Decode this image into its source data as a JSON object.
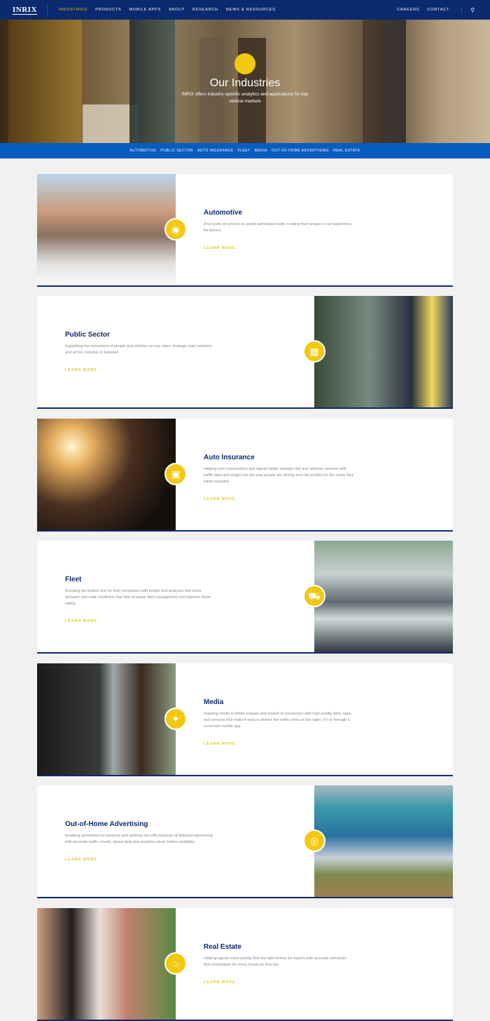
{
  "nav": {
    "logo": "INRIX",
    "items": [
      "INDUSTRIES",
      "PRODUCTS",
      "MOBILE APPS",
      "ABOUT",
      "RESEARCH",
      "NEWS & RESOURCES"
    ],
    "right": [
      "CAREERS",
      "CONTACT"
    ],
    "search_icon": "search-icon"
  },
  "hero": {
    "title": "Our Industries",
    "subtitle": "INRIX offers industry-specific analytics and applications for key vertical markets"
  },
  "subnav": [
    "AUTOMOTIVE",
    "PUBLIC SECTOR",
    "AUTO INSURANCE",
    "FLEET",
    "MEDIA",
    "OUT-OF-HOME ADVERTISING",
    "REAL ESTATE"
  ],
  "colors": {
    "navy": "#0b2a6f",
    "blue": "#0b5cc0",
    "yellow": "#f2c811"
  },
  "industries": [
    {
      "title": "Automotive",
      "desc": "A full suite of services to assist automakers with creating their unique in-car experience for drivers.",
      "link": "LEARN MORE",
      "icon": "car-icon"
    },
    {
      "title": "Public Sector",
      "desc": "Expediting the movement of people and vehicles across cities, strategic road networks and all the corridors in between",
      "link": "LEARN MORE",
      "icon": "government-building-icon"
    },
    {
      "title": "Auto Insurance",
      "desc": "Helping auto underwriters and agents better manage risk and optimize revenue with traffic data and insight into the way people are driving and risk profiles for the roads they travel regularly.",
      "link": "LEARN MORE",
      "icon": "insurance-icon"
    },
    {
      "title": "Fleet",
      "desc": "Boosting the bottom line for fleet companies with insight and analytics into driver behavior and road conditions that help increase fleet management and improve driver safety.",
      "link": "LEARN MORE",
      "icon": "truck-icon"
    },
    {
      "title": "Media",
      "desc": "Inspiring media to better engage and market to consumers with high-quality data, apps, and services that make it easy to deliver live traffic news on the radio, TV or through a consumer mobile app.",
      "link": "LEARN MORE",
      "icon": "satellite-icon"
    },
    {
      "title": "Out-of-Home Advertising",
      "desc": "Enabling advertisers to measure and optimize the effectiveness of billboard advertising with accurate traffic counts, speed data and analytics never before available.",
      "link": "LEARN MORE",
      "icon": "globe-icon"
    },
    {
      "title": "Real Estate",
      "desc": "Helping agents more quickly find the right homes for buyers with accurate commute-time information for every house on their list.",
      "link": "LEARN MORE",
      "icon": "house-icon"
    }
  ]
}
